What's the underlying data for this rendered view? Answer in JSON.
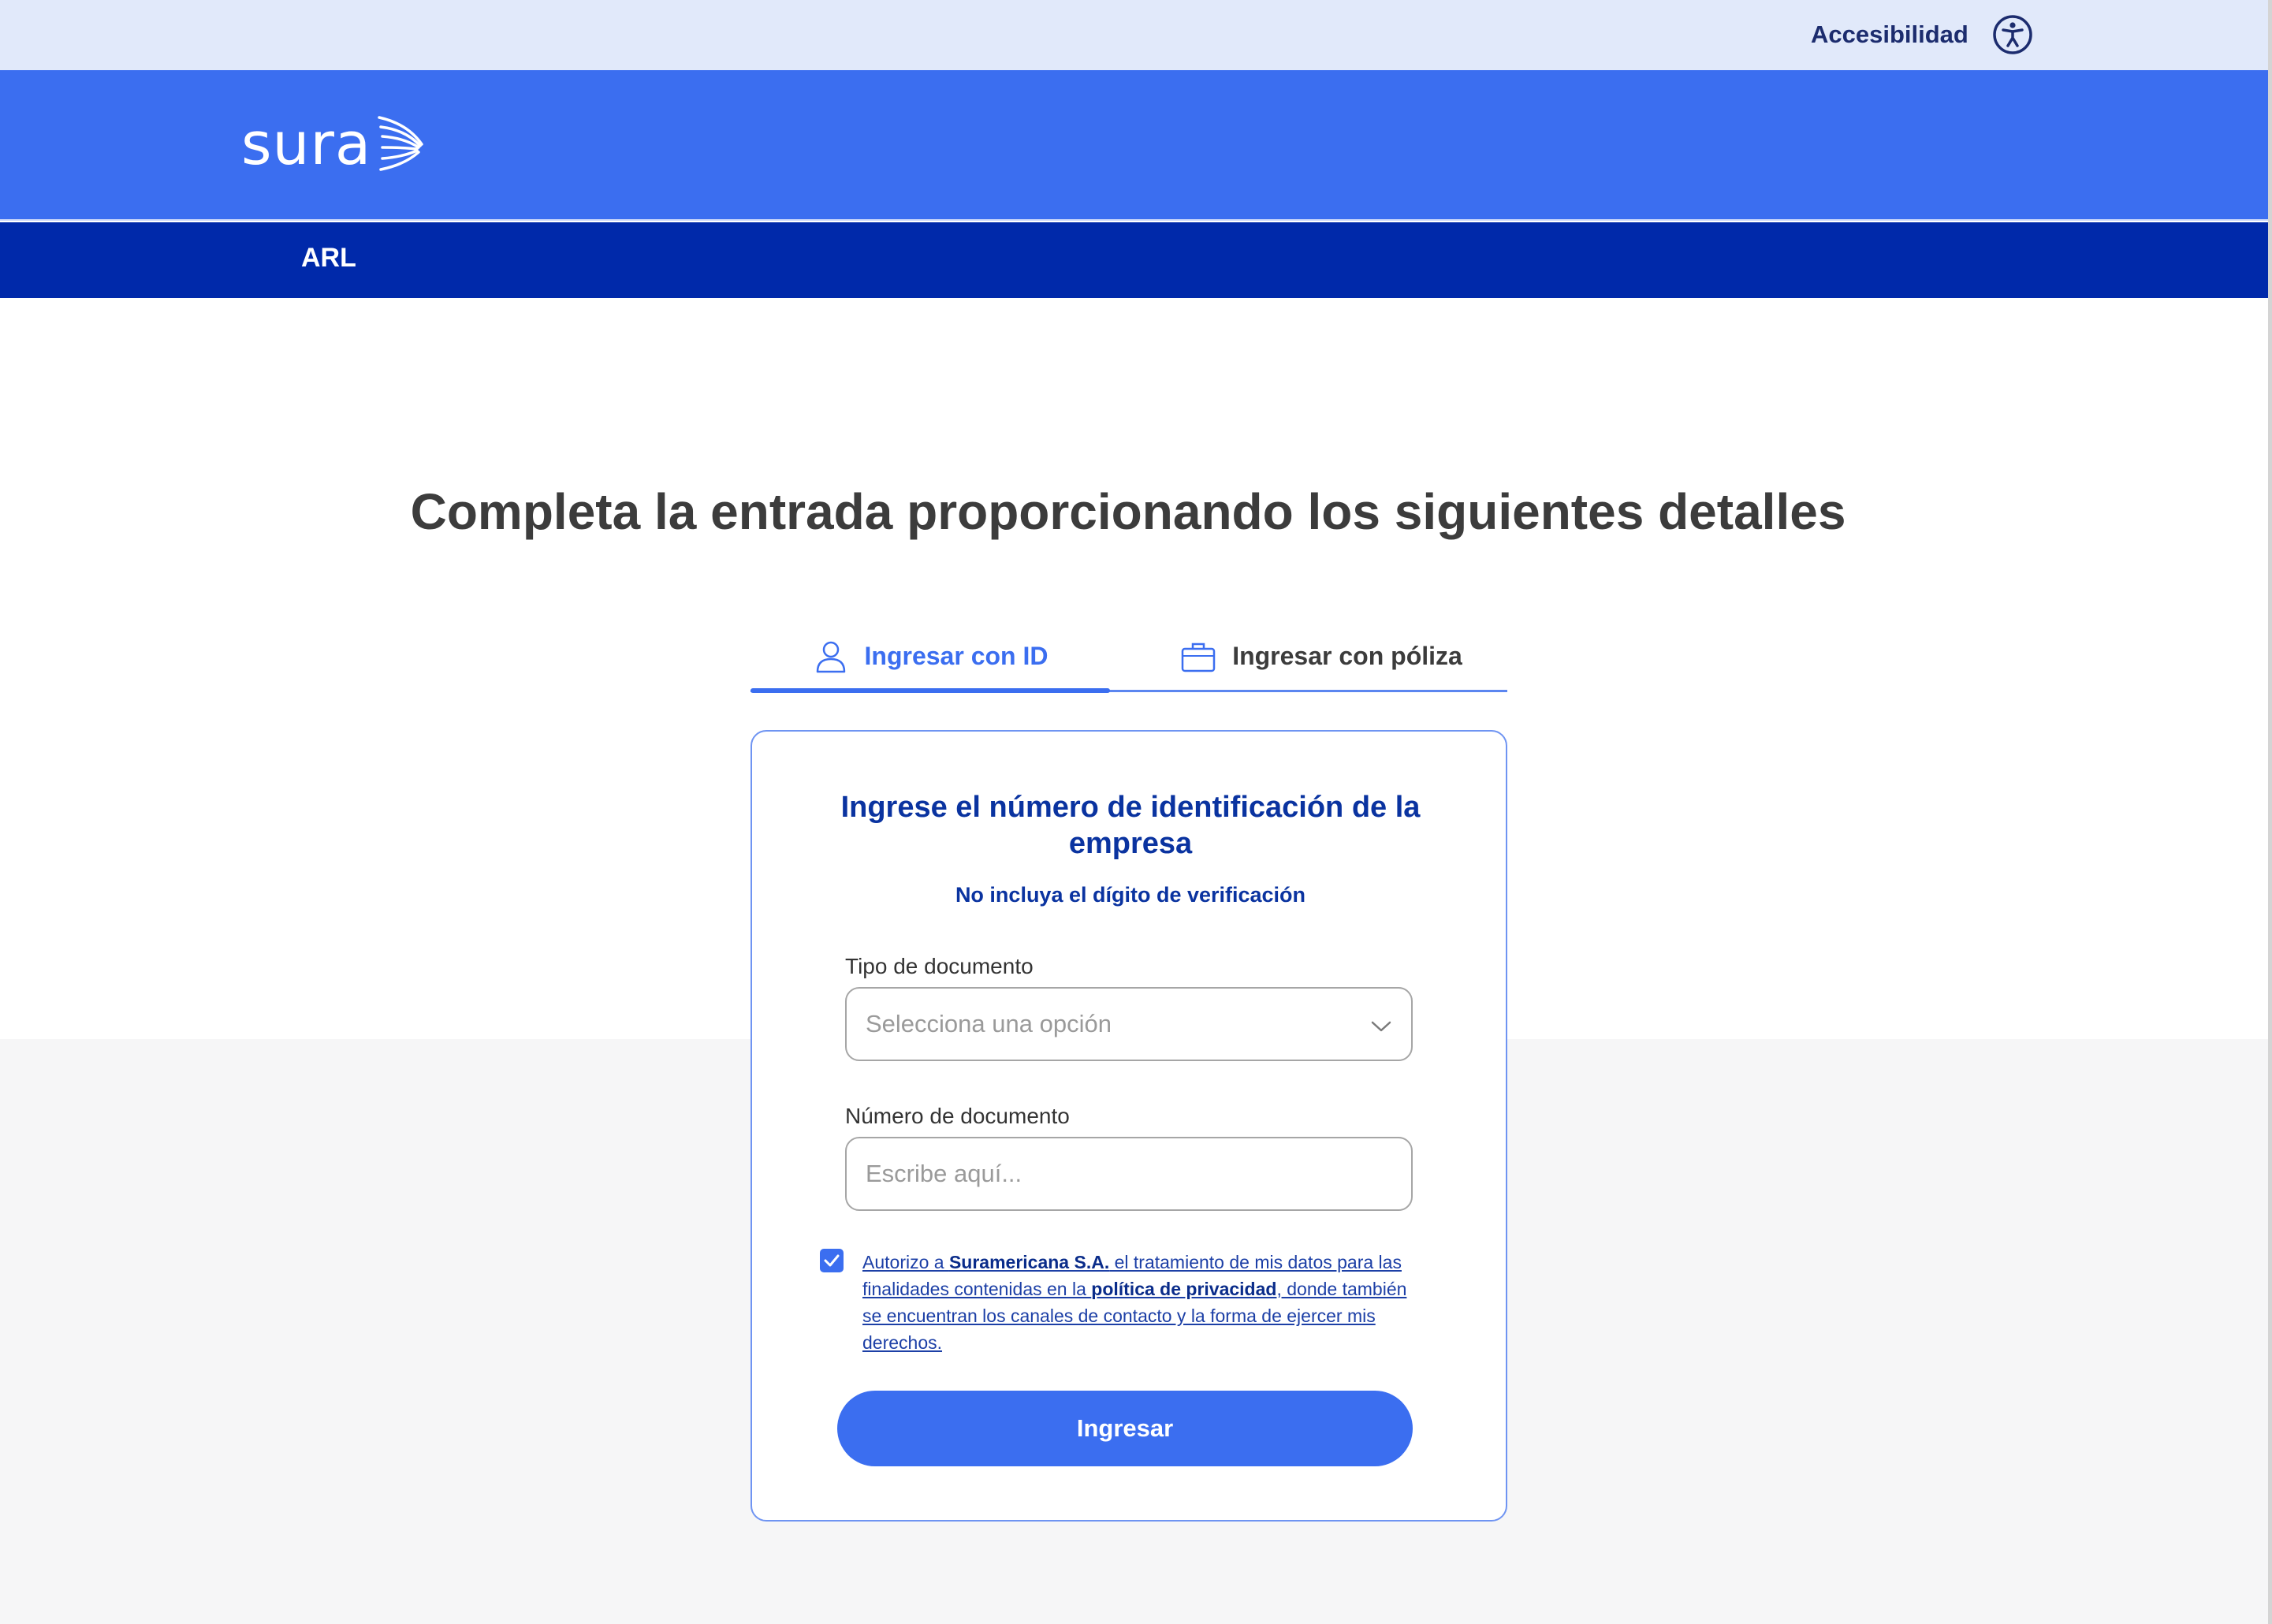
{
  "utility_bar": {
    "accessibility_label": "Accesibilidad"
  },
  "brand": {
    "logo_text": "sura"
  },
  "section_bar": {
    "label": "ARL"
  },
  "main": {
    "headline": "Completa la entrada proporcionando los siguientes detalles",
    "tabs": [
      {
        "label": "Ingresar con ID",
        "icon": "user-icon",
        "active": true
      },
      {
        "label": "Ingresar con póliza",
        "icon": "briefcase-icon",
        "active": false
      }
    ]
  },
  "form": {
    "title": "Ingrese el número de identificación de la empresa",
    "subtitle": "No incluya el dígito de verificación",
    "doc_type": {
      "label": "Tipo de documento",
      "placeholder": "Selecciona una opción"
    },
    "doc_number": {
      "label": "Número de documento",
      "placeholder": "Escribe aquí..."
    },
    "consent": {
      "checked": true,
      "part1": "Autorizo a ",
      "company": "Suramericana S.A.",
      "part2": " el tratamiento de mis datos para las finalidades contenidas en la ",
      "policy": "política de privacidad",
      "part3": ", donde también se encuentran los canales de contacto y la forma de ejercer mis derechos."
    },
    "submit_label": "Ingresar"
  },
  "colors": {
    "primary": "#3b6ef0",
    "navy": "#0029aa",
    "utility_bg": "#e1e9fa",
    "text_dark": "#3c3c3c",
    "form_title": "#0a33a0"
  }
}
